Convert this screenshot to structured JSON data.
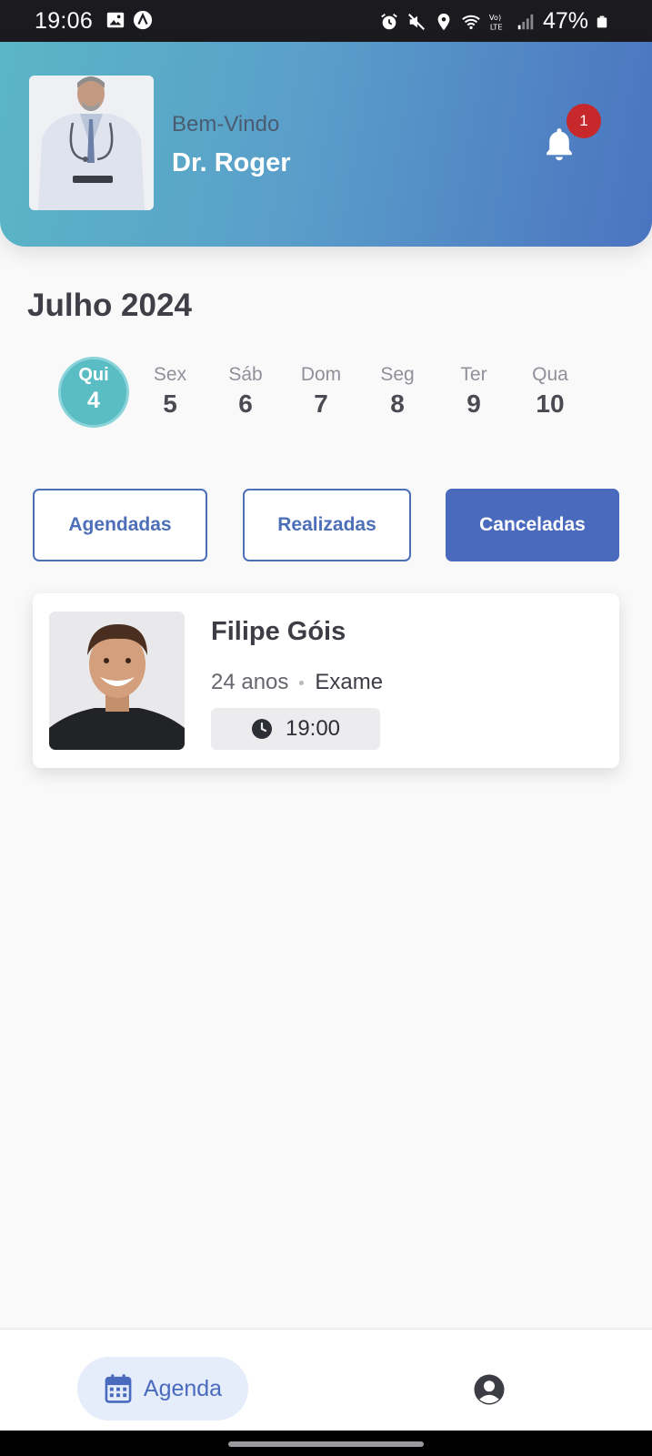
{
  "status_bar": {
    "time": "19:06",
    "battery_percent": "47%",
    "icons": [
      "image-icon",
      "app-notification-icon",
      "alarm-icon",
      "mute-icon",
      "location-icon",
      "wifi-icon",
      "volte-icon",
      "signal-icon",
      "battery-icon"
    ]
  },
  "header": {
    "welcome": "Bem-Vindo",
    "doctor_name": "Dr. Roger",
    "notification_count": "1",
    "gradient_colors": [
      "#5ab6c6",
      "#4b74c0"
    ]
  },
  "calendar": {
    "month_label": "Julho 2024",
    "days": [
      {
        "name": "Qui",
        "date": "4",
        "selected": true
      },
      {
        "name": "Sex",
        "date": "5",
        "selected": false
      },
      {
        "name": "Sáb",
        "date": "6",
        "selected": false
      },
      {
        "name": "Dom",
        "date": "7",
        "selected": false
      },
      {
        "name": "Seg",
        "date": "8",
        "selected": false
      },
      {
        "name": "Ter",
        "date": "9",
        "selected": false
      },
      {
        "name": "Qua",
        "date": "10",
        "selected": false
      }
    ],
    "accent_color": "#5bbdc4"
  },
  "filters": {
    "agendadas": "Agendadas",
    "realizadas": "Realizadas",
    "canceladas": "Canceladas",
    "active": "canceladas",
    "accent_color": "#4a6bbd"
  },
  "appointment": {
    "name": "Filipe Góis",
    "age": "24 anos",
    "type": "Exame",
    "time": "19:00"
  },
  "bottom_nav": {
    "agenda_label": "Agenda"
  }
}
